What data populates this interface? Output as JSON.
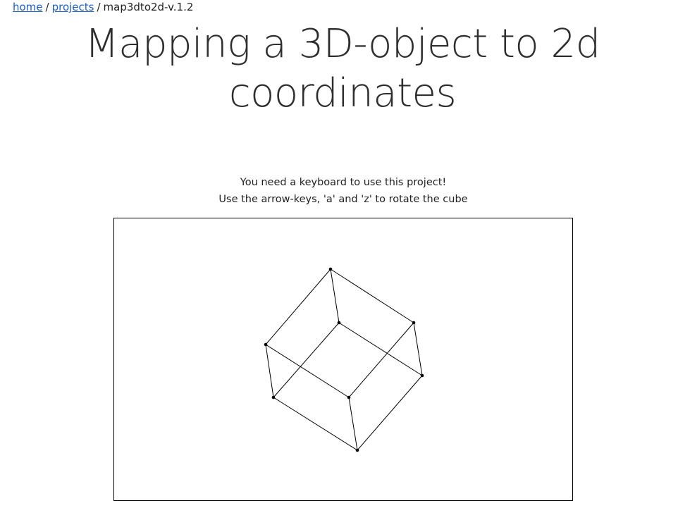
{
  "breadcrumb": {
    "home": "home",
    "projects": "projects",
    "separator": "/",
    "current": "map3dto2d-v.1.2"
  },
  "title": "Mapping a 3D-object to 2d coordinates",
  "instructions": {
    "line1": "You need a keyboard to use this project!",
    "line2": "Use the arrow-keys, 'a' and 'z' to rotate the cube"
  },
  "colors": {
    "link": "#1a5fd0",
    "edge": "#000000"
  }
}
